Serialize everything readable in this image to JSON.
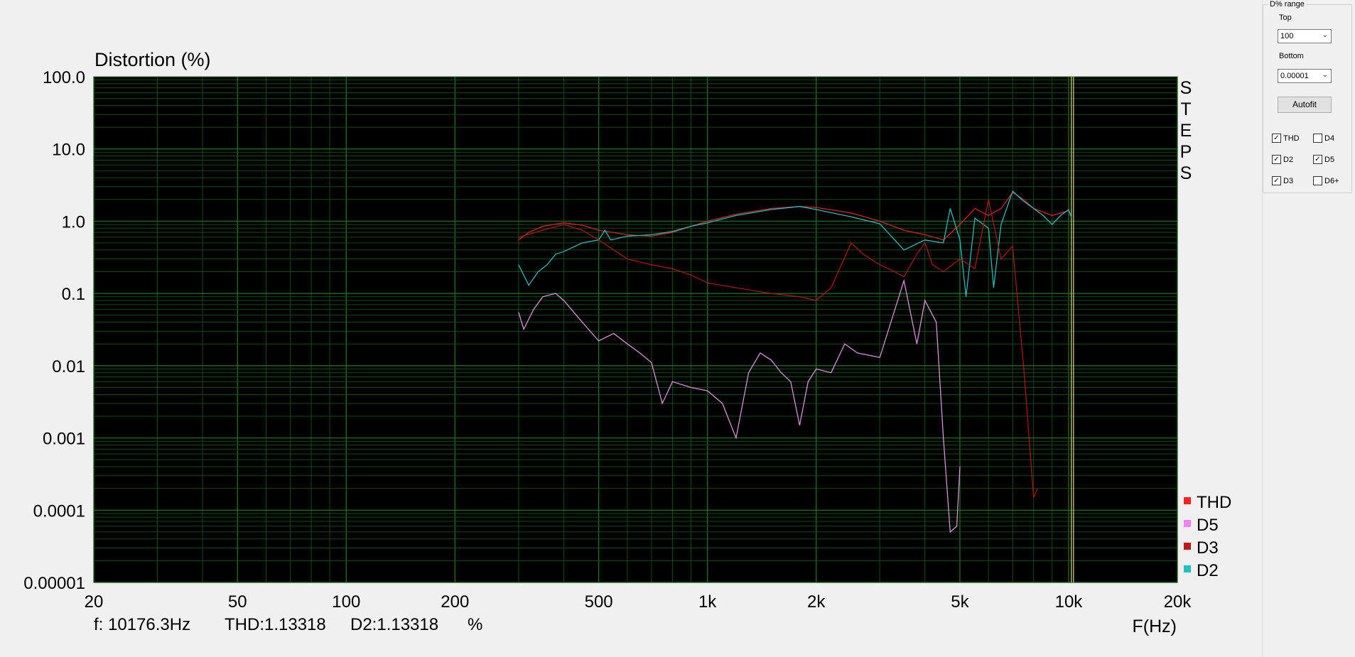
{
  "chart_data": {
    "type": "line",
    "title": "Distortion (%)",
    "xlabel": "F(Hz)",
    "x_scale": "log",
    "y_scale": "log",
    "xlim": [
      20,
      20000
    ],
    "ylim": [
      1e-05,
      100
    ],
    "x_ticks": [
      {
        "value": 20,
        "label": "20"
      },
      {
        "value": 50,
        "label": "50"
      },
      {
        "value": 100,
        "label": "100"
      },
      {
        "value": 200,
        "label": "200"
      },
      {
        "value": 500,
        "label": "500"
      },
      {
        "value": 1000,
        "label": "1k"
      },
      {
        "value": 2000,
        "label": "2k"
      },
      {
        "value": 5000,
        "label": "5k"
      },
      {
        "value": 10000,
        "label": "10k"
      },
      {
        "value": 20000,
        "label": "20k"
      }
    ],
    "y_ticks": [
      {
        "value": 100,
        "label": "100.0"
      },
      {
        "value": 10,
        "label": "10.0"
      },
      {
        "value": 1,
        "label": "1.0"
      },
      {
        "value": 0.1,
        "label": "0.1"
      },
      {
        "value": 0.01,
        "label": "0.01"
      },
      {
        "value": 0.001,
        "label": "0.001"
      },
      {
        "value": 0.0001,
        "label": "0.0001"
      },
      {
        "value": 1e-05,
        "label": "0.00001"
      }
    ],
    "side_label": "STEPS",
    "cursor_x": 10176.3,
    "legend": [
      {
        "name": "THD",
        "color": "#ff2020"
      },
      {
        "name": "D5",
        "color": "#ff80ff"
      },
      {
        "name": "D3",
        "color": "#c01818"
      },
      {
        "name": "D2",
        "color": "#20c0c0"
      }
    ],
    "series": [
      {
        "name": "THD",
        "color": "#d02424",
        "points": [
          [
            300,
            0.55
          ],
          [
            320,
            0.7
          ],
          [
            350,
            0.85
          ],
          [
            400,
            0.95
          ],
          [
            450,
            0.88
          ],
          [
            500,
            0.75
          ],
          [
            600,
            0.65
          ],
          [
            700,
            0.62
          ],
          [
            800,
            0.7
          ],
          [
            900,
            0.85
          ],
          [
            1000,
            1.0
          ],
          [
            1200,
            1.25
          ],
          [
            1500,
            1.5
          ],
          [
            1800,
            1.6
          ],
          [
            2000,
            1.55
          ],
          [
            2500,
            1.3
          ],
          [
            3000,
            1.0
          ],
          [
            3500,
            0.75
          ],
          [
            4000,
            0.65
          ],
          [
            4500,
            0.55
          ],
          [
            5000,
            0.9
          ],
          [
            5500,
            1.5
          ],
          [
            6000,
            1.2
          ],
          [
            6500,
            1.5
          ],
          [
            7000,
            2.5
          ],
          [
            7500,
            2.0
          ],
          [
            8000,
            1.5
          ],
          [
            9000,
            1.2
          ],
          [
            10000,
            1.4
          ],
          [
            10176,
            1.13
          ]
        ]
      },
      {
        "name": "D2",
        "color": "#30b8b8",
        "points": [
          [
            300,
            0.25
          ],
          [
            320,
            0.13
          ],
          [
            340,
            0.2
          ],
          [
            360,
            0.25
          ],
          [
            380,
            0.35
          ],
          [
            400,
            0.38
          ],
          [
            450,
            0.5
          ],
          [
            500,
            0.55
          ],
          [
            520,
            0.75
          ],
          [
            540,
            0.55
          ],
          [
            600,
            0.62
          ],
          [
            700,
            0.65
          ],
          [
            800,
            0.72
          ],
          [
            900,
            0.85
          ],
          [
            1000,
            0.95
          ],
          [
            1200,
            1.2
          ],
          [
            1500,
            1.45
          ],
          [
            1800,
            1.6
          ],
          [
            2000,
            1.45
          ],
          [
            2500,
            1.15
          ],
          [
            3000,
            0.92
          ],
          [
            3300,
            0.55
          ],
          [
            3500,
            0.4
          ],
          [
            4000,
            0.55
          ],
          [
            4500,
            0.5
          ],
          [
            4700,
            1.5
          ],
          [
            5000,
            0.55
          ],
          [
            5200,
            0.09
          ],
          [
            5500,
            1.1
          ],
          [
            6000,
            0.8
          ],
          [
            6200,
            0.12
          ],
          [
            6500,
            0.9
          ],
          [
            7000,
            2.6
          ],
          [
            7500,
            1.9
          ],
          [
            8000,
            1.5
          ],
          [
            8500,
            1.2
          ],
          [
            9000,
            0.9
          ],
          [
            9500,
            1.2
          ],
          [
            10000,
            1.45
          ],
          [
            10176,
            1.13
          ]
        ]
      },
      {
        "name": "D3",
        "color": "#a81616",
        "points": [
          [
            300,
            0.6
          ],
          [
            350,
            0.75
          ],
          [
            400,
            0.9
          ],
          [
            450,
            0.75
          ],
          [
            500,
            0.55
          ],
          [
            600,
            0.3
          ],
          [
            700,
            0.25
          ],
          [
            800,
            0.22
          ],
          [
            900,
            0.18
          ],
          [
            1000,
            0.14
          ],
          [
            1200,
            0.12
          ],
          [
            1500,
            0.1
          ],
          [
            1800,
            0.09
          ],
          [
            2000,
            0.08
          ],
          [
            2200,
            0.12
          ],
          [
            2500,
            0.5
          ],
          [
            2700,
            0.35
          ],
          [
            3000,
            0.25
          ],
          [
            3300,
            0.2
          ],
          [
            3500,
            0.17
          ],
          [
            3800,
            0.35
          ],
          [
            4000,
            0.5
          ],
          [
            4200,
            0.25
          ],
          [
            4500,
            0.2
          ],
          [
            5000,
            0.3
          ],
          [
            5500,
            0.22
          ],
          [
            6000,
            2.0
          ],
          [
            6500,
            0.3
          ],
          [
            7000,
            0.45
          ],
          [
            7500,
            0.01
          ],
          [
            8000,
            0.00015
          ],
          [
            8200,
            0.0002
          ]
        ]
      },
      {
        "name": "D5",
        "color": "#d890d8",
        "points": [
          [
            300,
            0.055
          ],
          [
            310,
            0.032
          ],
          [
            330,
            0.06
          ],
          [
            350,
            0.09
          ],
          [
            380,
            0.1
          ],
          [
            400,
            0.08
          ],
          [
            450,
            0.04
          ],
          [
            500,
            0.022
          ],
          [
            550,
            0.028
          ],
          [
            600,
            0.02
          ],
          [
            650,
            0.015
          ],
          [
            700,
            0.011
          ],
          [
            750,
            0.003
          ],
          [
            800,
            0.006
          ],
          [
            900,
            0.005
          ],
          [
            1000,
            0.0045
          ],
          [
            1100,
            0.003
          ],
          [
            1200,
            0.001
          ],
          [
            1300,
            0.008
          ],
          [
            1400,
            0.015
          ],
          [
            1500,
            0.012
          ],
          [
            1600,
            0.008
          ],
          [
            1700,
            0.006
          ],
          [
            1800,
            0.0015
          ],
          [
            1900,
            0.006
          ],
          [
            2000,
            0.009
          ],
          [
            2200,
            0.008
          ],
          [
            2400,
            0.02
          ],
          [
            2600,
            0.015
          ],
          [
            3000,
            0.013
          ],
          [
            3500,
            0.15
          ],
          [
            3800,
            0.02
          ],
          [
            4000,
            0.08
          ],
          [
            4300,
            0.04
          ],
          [
            4500,
            0.001
          ],
          [
            4700,
            5e-05
          ],
          [
            4900,
            6e-05
          ],
          [
            5000,
            0.0004
          ]
        ]
      }
    ]
  },
  "cursor_readout": {
    "freq": "f: 10176.3Hz",
    "thd": "THD:1.13318",
    "d2": "D2:1.13318",
    "unit": "%"
  },
  "panel": {
    "group_title": "D% range",
    "top_label": "Top",
    "top_value": "100",
    "bottom_label": "Bottom",
    "bottom_value": "0.00001",
    "autofit_label": "Autofit",
    "checkboxes": [
      {
        "label": "THD",
        "checked": true
      },
      {
        "label": "D4",
        "checked": false
      },
      {
        "label": "D2",
        "checked": true
      },
      {
        "label": "D5",
        "checked": true
      },
      {
        "label": "D3",
        "checked": true
      },
      {
        "label": "D6+",
        "checked": false
      }
    ]
  },
  "colors": {
    "plot_bg": "#000000",
    "grid": "#1f6b1f",
    "grid_minor": "#154a15",
    "cursor": "#c8c880"
  }
}
